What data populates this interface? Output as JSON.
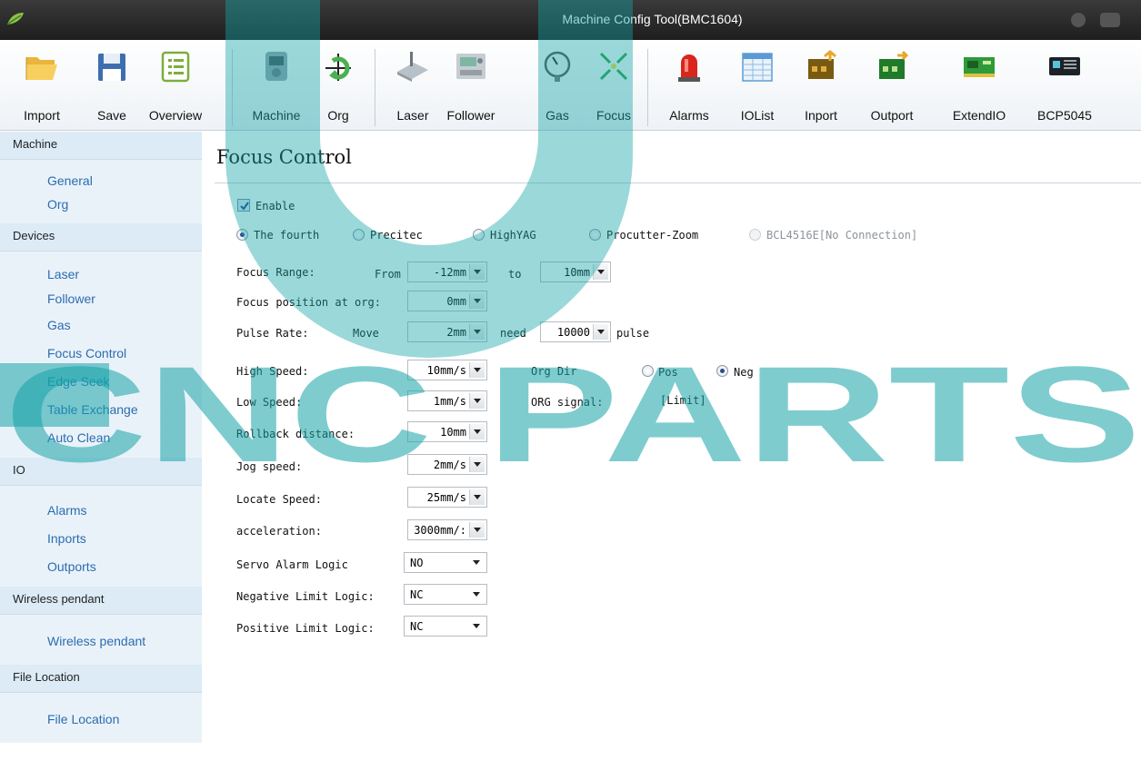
{
  "window": {
    "title": "Machine Config Tool(BMC1604)"
  },
  "toolbar": {
    "items": [
      {
        "label": "Import",
        "icon": "folder-open-icon"
      },
      {
        "label": "Save",
        "icon": "floppy-disk-icon"
      },
      {
        "label": "Overview",
        "icon": "list-icon"
      },
      {
        "label": "Machine",
        "icon": "machine-icon"
      },
      {
        "label": "Org",
        "icon": "org-arrow-icon"
      },
      {
        "label": "Laser",
        "icon": "laser-icon"
      },
      {
        "label": "Follower",
        "icon": "follower-icon"
      },
      {
        "label": "Gas",
        "icon": "gauge-icon"
      },
      {
        "label": "Focus",
        "icon": "focus-arrows-icon"
      },
      {
        "label": "Alarms",
        "icon": "alarm-light-icon"
      },
      {
        "label": "IOList",
        "icon": "table-icon"
      },
      {
        "label": "Inport",
        "icon": "inport-icon"
      },
      {
        "label": "Outport",
        "icon": "outport-icon"
      },
      {
        "label": "ExtendIO",
        "icon": "circuit-board-icon"
      },
      {
        "label": "BCP5045",
        "icon": "controller-panel-icon"
      }
    ]
  },
  "sidebar": {
    "machine": {
      "header": "Machine",
      "items": [
        "General",
        "Org"
      ]
    },
    "devices": {
      "header": "Devices",
      "items": [
        "Laser",
        "Follower",
        "Gas",
        "Focus Control",
        "Edge Seek",
        "Table Exchange",
        "Auto Clean"
      ]
    },
    "io": {
      "header": "IO",
      "items": [
        "Alarms",
        "Inports",
        "Outports"
      ]
    },
    "wireless": {
      "header": "Wireless pendant",
      "items": [
        "Wireless pendant"
      ]
    },
    "file": {
      "header": "File Location",
      "items": [
        "File Location"
      ]
    }
  },
  "main": {
    "title": "Focus Control",
    "enable_label": "Enable",
    "enable_checked": true,
    "types": [
      {
        "label": "The fourth",
        "selected": true,
        "disabled": false
      },
      {
        "label": "Precitec",
        "selected": false,
        "disabled": false
      },
      {
        "label": "HighYAG",
        "selected": false,
        "disabled": false
      },
      {
        "label": "Procutter-Zoom",
        "selected": false,
        "disabled": false
      },
      {
        "label": "BCL4516E[No Connection]",
        "selected": false,
        "disabled": true
      }
    ],
    "focus_range": {
      "label": "Focus Range:",
      "from_label": "From",
      "from": "-12mm",
      "to_label": "to",
      "to": "10mm"
    },
    "focus_org": {
      "label": "Focus position at org:",
      "value": "0mm"
    },
    "pulse_rate": {
      "label": "Pulse Rate:",
      "move_label": "Move",
      "move": "2mm",
      "need_label": "need",
      "need": "10000",
      "pulse_label": "pulse"
    },
    "high_speed": {
      "label": "High Speed:",
      "value": "10mm/s"
    },
    "org_dir": {
      "label": "Org Dir",
      "pos": "Pos",
      "neg": "Neg",
      "selected": "Neg"
    },
    "low_speed": {
      "label": "Low Speed:",
      "value": "1mm/s"
    },
    "org_signal": {
      "label": "ORG signal:",
      "value": "[Limit]"
    },
    "rollback": {
      "label": "Rollback distance:",
      "value": "10mm"
    },
    "jog_speed": {
      "label": "Jog speed:",
      "value": "2mm/s"
    },
    "locate_speed": {
      "label": "Locate Speed:",
      "value": "25mm/s"
    },
    "acceleration": {
      "label": "acceleration:",
      "value": "3000mm/:"
    },
    "servo_alarm": {
      "label": "Servo Alarm Logic",
      "value": "NO"
    },
    "neg_limit": {
      "label": "Negative Limit Logic:",
      "value": "NC"
    },
    "pos_limit": {
      "label": "Positive Limit Logic:",
      "value": "NC"
    }
  },
  "colors": {
    "sidebar_link": "#2b6cb0",
    "sidebar_header": "#dcebf6",
    "watermark": "#16a3a8"
  },
  "watermark": {
    "text": "CNC PARTS"
  }
}
